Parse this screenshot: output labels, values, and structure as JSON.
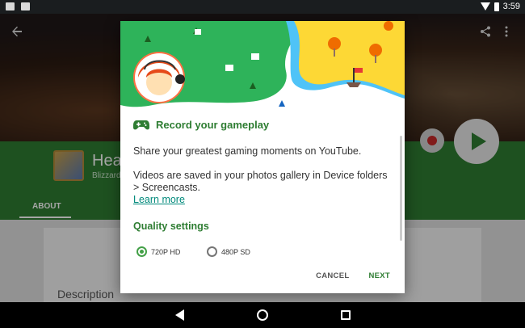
{
  "status_bar": {
    "time": "3:59"
  },
  "app": {
    "name": "Hea",
    "developer": "Blizzard",
    "tab_about": "ABOUT",
    "description_label": "Description"
  },
  "dialog": {
    "title": "Record your gameplay",
    "body_1": "Share your greatest gaming moments on YouTube.",
    "body_2": "Videos are saved in your photos gallery in Device folders > Screencasts.",
    "learn_more": "Learn more",
    "quality_title": "Quality settings",
    "quality_options": [
      {
        "label": "720P HD",
        "selected": true
      },
      {
        "label": "480P SD",
        "selected": false
      }
    ],
    "cancel_label": "CANCEL",
    "next_label": "NEXT"
  },
  "colors": {
    "accent_green": "#2e7d32",
    "link_teal": "#00897b",
    "radio_green": "#43a047"
  },
  "icons": {
    "back": "arrow-back-icon",
    "share": "share-icon",
    "more": "more-vert-icon",
    "gamepad": "gamepad-icon",
    "play": "play-icon",
    "record": "record-icon"
  }
}
